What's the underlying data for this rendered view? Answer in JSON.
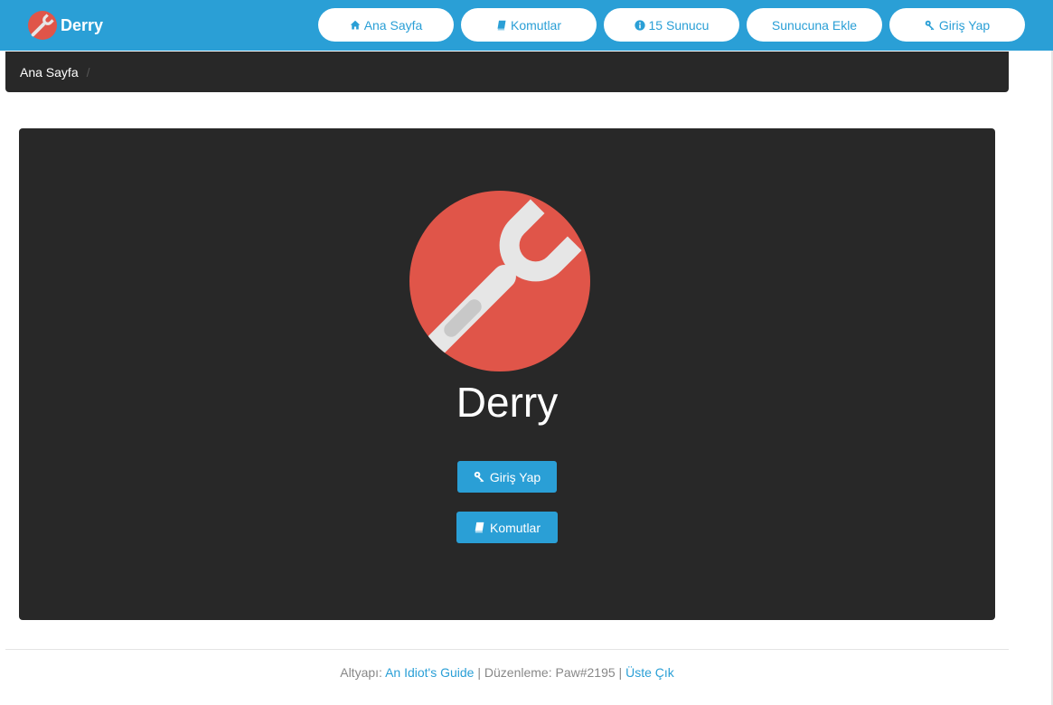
{
  "brand": {
    "name": "Derry"
  },
  "nav": {
    "home": "Ana Sayfa",
    "commands": "Komutlar",
    "servers": "15 Sunucu",
    "add_server": "Sunucuna Ekle",
    "login": "Giriş Yap"
  },
  "breadcrumb": {
    "current": "Ana Sayfa",
    "separator": "/"
  },
  "hero": {
    "title": "Derry",
    "login_label": "Giriş Yap",
    "commands_label": "Komutlar"
  },
  "footer": {
    "prefix": "Altyapı:",
    "guide_link": "An Idiot's Guide",
    "separator1": "|",
    "edit_text": "Düzenleme: Paw#2195",
    "separator2": "|",
    "top_link": "Üste Çık"
  },
  "colors": {
    "accent": "#2a9fd6",
    "dark_panel": "#282828",
    "logo_red": "#e05549",
    "wrench": "#e6e6e6"
  },
  "icons": {
    "brand": "wrench-logo",
    "home": "home-icon",
    "commands": "book-icon",
    "servers": "info-circle-icon",
    "login": "key-icon"
  }
}
